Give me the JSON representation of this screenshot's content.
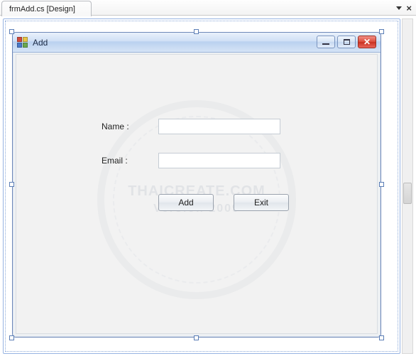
{
  "document_tab": {
    "title": "frmAdd.cs [Design]"
  },
  "winform": {
    "title": "Add"
  },
  "fields": {
    "name": {
      "label": "Name :",
      "value": ""
    },
    "email": {
      "label": "Email :",
      "value": ""
    }
  },
  "buttons": {
    "add": "Add",
    "exit": "Exit"
  },
  "watermark": {
    "line1": "THAICREATE.COM",
    "line2": "Version 2009"
  }
}
